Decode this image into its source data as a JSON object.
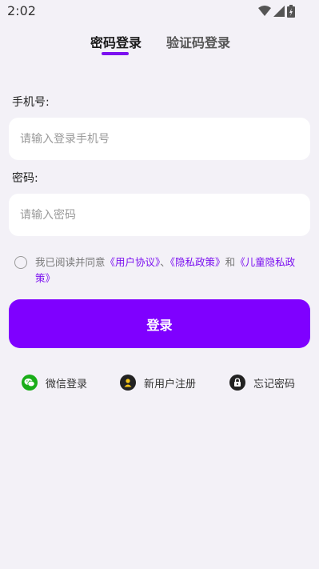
{
  "status_bar": {
    "time": "2:02"
  },
  "tabs": [
    {
      "label": "密码登录",
      "active": true
    },
    {
      "label": "验证码登录",
      "active": false
    }
  ],
  "phone": {
    "label": "手机号:",
    "placeholder": "请输入登录手机号",
    "value": ""
  },
  "password": {
    "label": "密码:",
    "placeholder": "请输入密码",
    "value": ""
  },
  "agreement": {
    "prefix": "我已阅读并同意",
    "user_agreement": "《用户协议》",
    "sep": "、",
    "privacy_policy": "《隐私政策》",
    "and": "和",
    "children_privacy": "《儿童隐私政策》"
  },
  "login_button": "登录",
  "bottom_links": {
    "wechat": "微信登录",
    "register": "新用户注册",
    "forgot": "忘记密码"
  },
  "colors": {
    "accent": "#7f00ff",
    "wechat": "#1aad19",
    "background": "#f3f1f7"
  }
}
